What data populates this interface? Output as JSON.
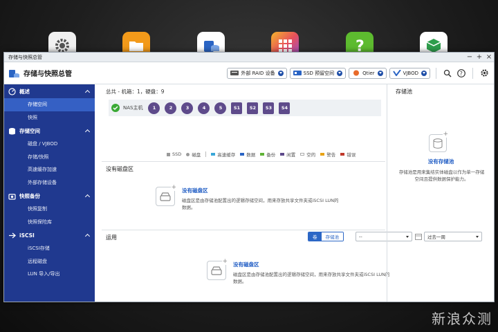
{
  "window": {
    "title": "存储与快照总管"
  },
  "header": {
    "app_title": "存储与快照总管",
    "tools": [
      {
        "label": "外部 RAID 设备",
        "icon": "raid-device-icon"
      },
      {
        "label": "SSD 预留空间",
        "icon": "ssd-icon"
      },
      {
        "label": "Qtier",
        "icon": "qtier-icon"
      },
      {
        "label": "VJBOD",
        "icon": "vjbod-icon"
      }
    ]
  },
  "sidebar": {
    "sections": [
      {
        "label": "概述",
        "icon": "overview-icon",
        "items": [
          "存储空间",
          "快照"
        ]
      },
      {
        "label": "存储空间",
        "icon": "storage-icon",
        "items": [
          "磁盘 / VJBOD",
          "存储/快照",
          "高速缓存加速",
          "外部存储设备"
        ]
      },
      {
        "label": "快照备份",
        "icon": "snapshot-backup-icon",
        "items": [
          "快照复制",
          "快照保险库"
        ]
      },
      {
        "label": "iSCSI",
        "icon": "iscsi-icon",
        "items": [
          "iSCSI存储",
          "远程磁盘",
          "LUN 导入/导出"
        ]
      }
    ],
    "active_item": "存储空间"
  },
  "main": {
    "summary": "总共 - 机箱：1，硬盘：9",
    "nas_label": "NAS主机",
    "slots": [
      "1",
      "2",
      "3",
      "4",
      "5",
      "S1",
      "S2",
      "S3",
      "S4"
    ],
    "legend": [
      {
        "label": "SSD",
        "color": "#9a9a9a"
      },
      {
        "label": "磁盘",
        "color": "#9a9a9a"
      },
      {
        "label": "高速缓存",
        "color": "#3aa7d8"
      },
      {
        "label": "数据",
        "color": "#2a64c4"
      },
      {
        "label": "备份",
        "color": "#5fb336"
      },
      {
        "label": "闲置",
        "color": "#5e4b8b"
      },
      {
        "label": "空的",
        "color": "#ffffff"
      },
      {
        "label": "警告",
        "color": "#e8a317"
      },
      {
        "label": "错误",
        "color": "#c0392b"
      }
    ],
    "no_disk_title": "没有磁盘区",
    "empty1": {
      "title": "没有磁盘区",
      "desc": "磁盘区是由存储池配置出的逻辑存储空间，用来存放共享文件夹或iSCSI LUN的数据。"
    },
    "ops": {
      "title": "运用",
      "seg_on": "卷",
      "seg_off": "存储池",
      "select1": "--",
      "select2": "过去一周"
    },
    "empty2": {
      "title": "没有磁盘区",
      "desc": "磁盘区是由存储池配置出的逻辑存储空间，用来存放共享文件夹或iSCSI LUN的数据。"
    }
  },
  "right": {
    "title": "存储池",
    "empty_title": "没有存储池",
    "empty_desc": "存储池是用来集结实体磁盘以作为单一存储空间且提供数据保护能力。"
  },
  "watermark": "新浪众测"
}
